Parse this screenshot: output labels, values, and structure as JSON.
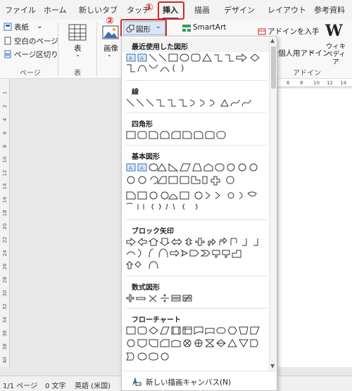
{
  "tabs": [
    "ファイル",
    "ホーム",
    "新しいタブ",
    "タッチ",
    "挿入",
    "描画",
    "デザイン",
    "レイアウト",
    "参考資料"
  ],
  "annotations": {
    "one": "①",
    "two": "②"
  },
  "ribbon": {
    "cover": "表紙",
    "blank_page": "空白のページ",
    "page_break": "ページ区切り",
    "pages_group": "ページ",
    "table": "表",
    "table_group": "表",
    "image": "画像",
    "shapes_button": "図形",
    "smartart": "SmartArt",
    "get_addins": "アドインを入手",
    "my_addins": "個人用アドイン",
    "wikipedia": "ウィキペディア",
    "addins_group": "アドイン"
  },
  "ruler": {
    "h_ticks": [
      "6",
      "8",
      "10",
      "12",
      "14"
    ],
    "v_ticks": [
      "1",
      "2",
      "4",
      "6",
      "8",
      "10",
      "12",
      "14",
      "16",
      "18",
      "20",
      "22",
      "24",
      "26",
      "28",
      "30",
      "32",
      "34",
      "36",
      "38",
      "40"
    ]
  },
  "shapes_menu": {
    "sections": [
      "最近使用した図形",
      "線",
      "四角形",
      "基本図形",
      "ブロック矢印",
      "数式図形",
      "フローチャート"
    ],
    "new_canvas": "新しい描画キャンバス(N)"
  },
  "status": {
    "page": "1/1 ページ",
    "words": "0 文字",
    "language": "英語 (米国)"
  }
}
